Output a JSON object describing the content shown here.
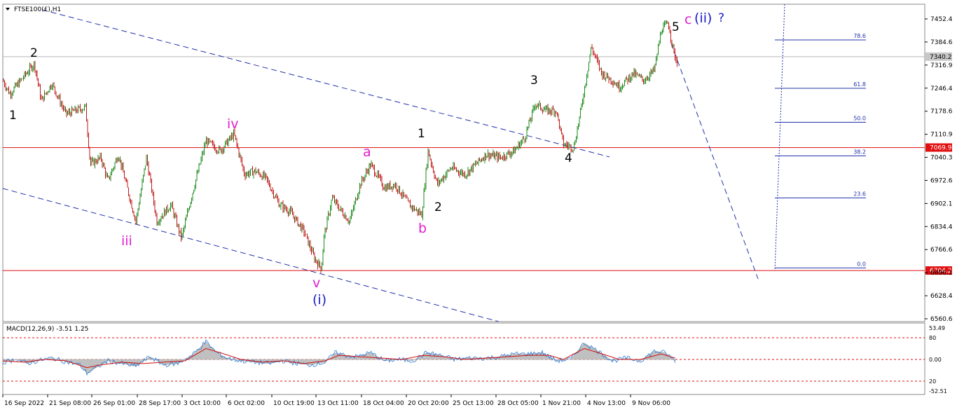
{
  "chart_data": {
    "type": "candlestick",
    "symbol_label": "FTSE100(£),H1",
    "y_ticks": [
      "7452.4",
      "7384.6",
      "7316.9",
      "7246.4",
      "7178.6",
      "7110.9",
      "7040.3",
      "6972.6",
      "6902.1",
      "6834.4",
      "6766.6",
      "6696.1",
      "6628.4",
      "6560.6"
    ],
    "x_ticks": [
      "16 Sep 2022",
      "21 Sep 08:00",
      "26 Sep 01:00",
      "28 Sep 17:00",
      "3 Oct 10:00",
      "6 Oct 02:00",
      "10 Oct 19:00",
      "13 Oct 11:00",
      "18 Oct 04:00",
      "20 Oct 20:00",
      "25 Oct 13:00",
      "28 Oct 05:00",
      "1 Nov 21:00",
      "4 Nov 13:00",
      "9 Nov 06:00"
    ],
    "ylim": [
      6540,
      7490
    ],
    "current_price": "7340.2",
    "hlines": [
      {
        "label": "7069.9",
        "value": 7069.9
      },
      {
        "label": "6704.2",
        "value": 6704.2
      }
    ],
    "price_path": [
      [
        0,
        7270
      ],
      [
        10,
        7230
      ],
      [
        22,
        7260
      ],
      [
        45,
        7320
      ],
      [
        55,
        7210
      ],
      [
        70,
        7260
      ],
      [
        90,
        7170
      ],
      [
        118,
        7190
      ],
      [
        125,
        7020
      ],
      [
        140,
        7040
      ],
      [
        150,
        6970
      ],
      [
        165,
        7050
      ],
      [
        190,
        6850
      ],
      [
        205,
        7040
      ],
      [
        220,
        6850
      ],
      [
        240,
        6900
      ],
      [
        255,
        6800
      ],
      [
        270,
        6930
      ],
      [
        290,
        7090
      ],
      [
        310,
        7060
      ],
      [
        330,
        7110
      ],
      [
        345,
        6990
      ],
      [
        360,
        7000
      ],
      [
        375,
        6980
      ],
      [
        395,
        6900
      ],
      [
        410,
        6880
      ],
      [
        430,
        6820
      ],
      [
        445,
        6740
      ],
      [
        455,
        6710
      ],
      [
        458,
        6800
      ],
      [
        470,
        6920
      ],
      [
        480,
        6890
      ],
      [
        495,
        6850
      ],
      [
        510,
        6960
      ],
      [
        525,
        7020
      ],
      [
        545,
        6950
      ],
      [
        560,
        6960
      ],
      [
        580,
        6900
      ],
      [
        598,
        6870
      ],
      [
        607,
        7060
      ],
      [
        620,
        6960
      ],
      [
        640,
        7010
      ],
      [
        660,
        6990
      ],
      [
        690,
        7050
      ],
      [
        710,
        7040
      ],
      [
        730,
        7060
      ],
      [
        745,
        7100
      ],
      [
        760,
        7200
      ],
      [
        775,
        7180
      ],
      [
        790,
        7180
      ],
      [
        800,
        7080
      ],
      [
        815,
        7070
      ],
      [
        825,
        7180
      ],
      [
        840,
        7370
      ],
      [
        855,
        7290
      ],
      [
        870,
        7270
      ],
      [
        880,
        7250
      ],
      [
        900,
        7290
      ],
      [
        915,
        7270
      ],
      [
        930,
        7300
      ],
      [
        940,
        7420
      ],
      [
        950,
        7440
      ],
      [
        958,
        7350
      ],
      [
        963,
        7320
      ]
    ],
    "fib": {
      "levels": [
        {
          "label": "78.6",
          "value": 7390
        },
        {
          "label": "61.8",
          "value": 7246
        },
        {
          "label": "50.0",
          "value": 7145
        },
        {
          "label": "38.2",
          "value": 7045
        },
        {
          "label": "23.6",
          "value": 6920
        },
        {
          "label": "0.0",
          "value": 6712
        }
      ]
    },
    "waves": {
      "wave1_black_left": "1",
      "wave2_black_left": "2",
      "wave_iii": "iii",
      "wave_iv": "iv",
      "wave_v": "v",
      "wave_i_blue": "(i)",
      "wave_a": "a",
      "wave_b": "b",
      "wave1_black": "1",
      "wave2_black": "2",
      "wave3_black": "3",
      "wave4_black": "4",
      "wave5_black": "5",
      "wave_c": "c",
      "wave_ii_blue": "(ii)",
      "question": "?"
    },
    "macd": {
      "label": "MACD(12,26,9) -3.51 1.25",
      "ticks": [
        "53.49",
        "80",
        "0.00",
        "20",
        "-52.51"
      ],
      "hist": [
        [
          0,
          -10
        ],
        [
          20,
          0
        ],
        [
          35,
          -15
        ],
        [
          50,
          -5
        ],
        [
          70,
          5
        ],
        [
          90,
          -8
        ],
        [
          110,
          -20
        ],
        [
          120,
          -50
        ],
        [
          130,
          -35
        ],
        [
          150,
          -5
        ],
        [
          170,
          -15
        ],
        [
          190,
          -25
        ],
        [
          210,
          10
        ],
        [
          230,
          -20
        ],
        [
          250,
          -15
        ],
        [
          270,
          15
        ],
        [
          290,
          65
        ],
        [
          305,
          25
        ],
        [
          320,
          5
        ],
        [
          340,
          -5
        ],
        [
          360,
          -10
        ],
        [
          380,
          -15
        ],
        [
          400,
          -5
        ],
        [
          420,
          -15
        ],
        [
          440,
          -20
        ],
        [
          460,
          -10
        ],
        [
          475,
          25
        ],
        [
          490,
          15
        ],
        [
          505,
          10
        ],
        [
          525,
          25
        ],
        [
          545,
          -5
        ],
        [
          565,
          0
        ],
        [
          585,
          -5
        ],
        [
          605,
          25
        ],
        [
          625,
          15
        ],
        [
          645,
          0
        ],
        [
          665,
          5
        ],
        [
          690,
          5
        ],
        [
          710,
          10
        ],
        [
          730,
          20
        ],
        [
          750,
          20
        ],
        [
          770,
          25
        ],
        [
          790,
          -5
        ],
        [
          810,
          0
        ],
        [
          830,
          60
        ],
        [
          850,
          30
        ],
        [
          870,
          -5
        ],
        [
          890,
          5
        ],
        [
          910,
          -5
        ],
        [
          930,
          30
        ],
        [
          945,
          25
        ],
        [
          960,
          -5
        ]
      ],
      "signal": [
        [
          0,
          -5
        ],
        [
          30,
          -10
        ],
        [
          60,
          0
        ],
        [
          90,
          -5
        ],
        [
          120,
          -30
        ],
        [
          140,
          -20
        ],
        [
          170,
          -10
        ],
        [
          200,
          -15
        ],
        [
          230,
          -10
        ],
        [
          260,
          -5
        ],
        [
          290,
          40
        ],
        [
          310,
          25
        ],
        [
          340,
          0
        ],
        [
          370,
          -10
        ],
        [
          400,
          -5
        ],
        [
          430,
          -15
        ],
        [
          460,
          -5
        ],
        [
          480,
          15
        ],
        [
          510,
          10
        ],
        [
          540,
          5
        ],
        [
          570,
          0
        ],
        [
          600,
          15
        ],
        [
          630,
          10
        ],
        [
          660,
          0
        ],
        [
          690,
          5
        ],
        [
          720,
          10
        ],
        [
          750,
          15
        ],
        [
          780,
          15
        ],
        [
          800,
          0
        ],
        [
          830,
          40
        ],
        [
          850,
          25
        ],
        [
          880,
          0
        ],
        [
          910,
          0
        ],
        [
          940,
          20
        ],
        [
          960,
          5
        ]
      ]
    }
  }
}
